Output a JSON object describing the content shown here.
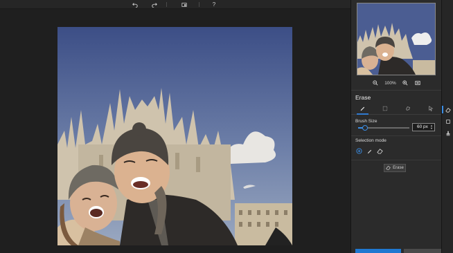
{
  "toolbar": {
    "undo_icon": "undo-icon",
    "redo_icon": "redo-icon",
    "compare_icon": "compare-icon",
    "help_label": "?"
  },
  "navigator": {
    "zoom_level": "100%",
    "zoom_out_icon": "zoom-out-icon",
    "zoom_in_icon": "zoom-in-icon",
    "fit_icon": "fit-screen-icon"
  },
  "panel": {
    "title": "Erase",
    "tabs": [
      {
        "icon": "brush-icon",
        "active": true
      },
      {
        "icon": "rect-select-icon",
        "active": false
      },
      {
        "icon": "lasso-icon",
        "active": false
      },
      {
        "icon": "pointer-select-icon",
        "active": false
      }
    ],
    "brush_size_label": "Brush Size",
    "brush_size_value": "60 px",
    "brush_size_fraction": 0.14,
    "selection_mode_label": "Selection mode",
    "selection_modes": [
      {
        "icon": "add-selection-icon",
        "active": true
      },
      {
        "icon": "brush-mode-icon",
        "active": false
      },
      {
        "icon": "eraser-mode-icon",
        "active": false
      }
    ],
    "erase_button_label": "Erase"
  },
  "side_strip": {
    "icons": [
      "eraser-tool-icon",
      "crop-tool-icon",
      "stamp-tool-icon"
    ]
  },
  "colors": {
    "accent": "#3a8ee6",
    "background": "#1f1f1f",
    "panel": "#2b2b2b"
  }
}
